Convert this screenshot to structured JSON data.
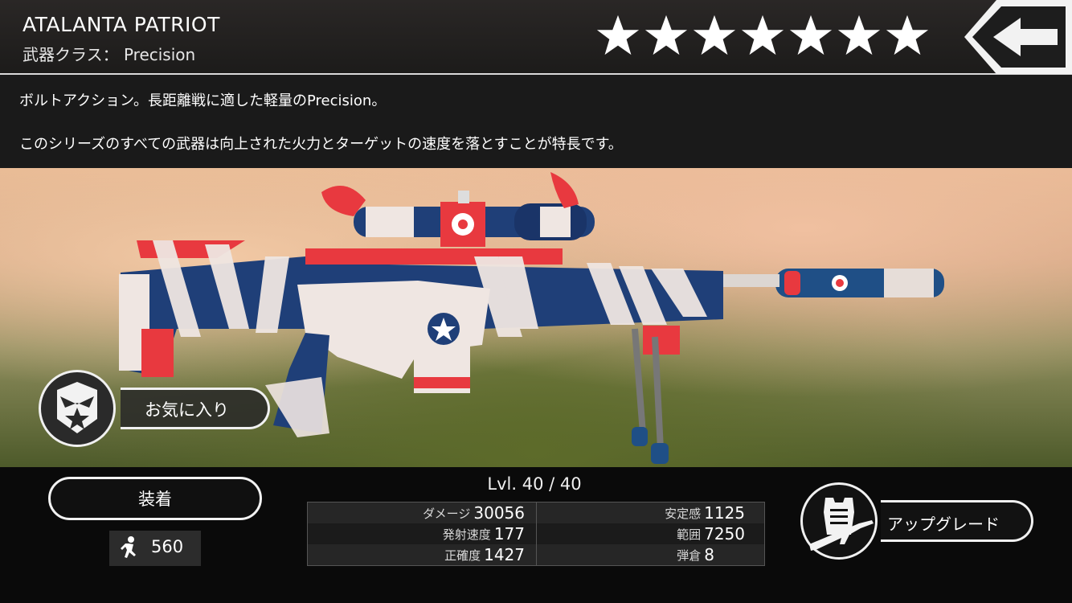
{
  "header": {
    "weapon_name": "ATALANTA PATRIOT",
    "weapon_class": "武器クラス： Precision",
    "star_rating": 7,
    "stars_max": 7
  },
  "description": {
    "line1": "ボルトアクション。長距離戦に適した軽量のPrecision。",
    "line2": "このシリーズのすべての武器は向上された火力とターゲットの速度を落とすことが特長です。"
  },
  "favorite": {
    "label": "お気に入り",
    "icon": "eagle-star-badge-icon"
  },
  "equip": {
    "label": "装着"
  },
  "cost": {
    "icon": "running-man-icon",
    "value": "560"
  },
  "level": {
    "text": "Lvl. 40 / 40"
  },
  "stats": {
    "left": [
      {
        "label": "ダメージ",
        "value": "30056"
      },
      {
        "label": "発射速度",
        "value": "177"
      },
      {
        "label": "正確度",
        "value": "1427"
      }
    ],
    "right": [
      {
        "label": "安定感",
        "value": "1125"
      },
      {
        "label": "範囲",
        "value": "7250"
      },
      {
        "label": "弾倉",
        "value": "8"
      }
    ]
  },
  "upgrade": {
    "label": "アップグレード",
    "icon": "armor-and-rifle-icon"
  },
  "colors": {
    "accent_red": "#e8393f",
    "accent_blue": "#1f3f78",
    "wrap_white": "#efe6e2"
  }
}
